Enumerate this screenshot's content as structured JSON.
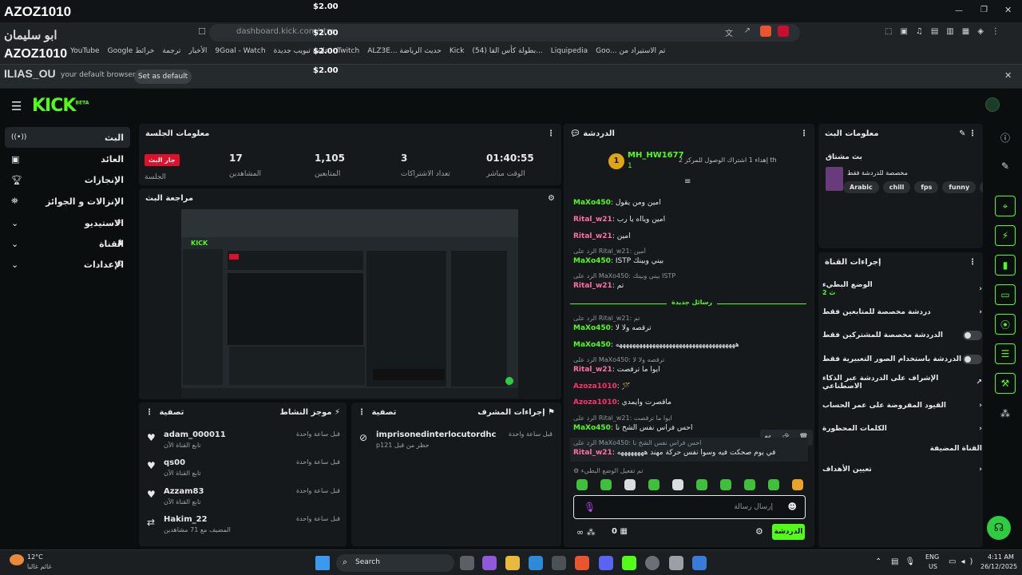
{
  "overlay": {
    "line1": "AZOZ1010",
    "line2": "ابو سليمان",
    "line3": "AZOZ1010",
    "line4": "ILIAS_OU",
    "donations": [
      "$2.00",
      "$2.00",
      "$2.00",
      "$2.00"
    ]
  },
  "browser": {
    "url": "dashboard.kick.com/stre",
    "default_prompt": "your default browser",
    "set_default": "Set as default",
    "bookmarks": [
      "YouTube",
      "Google خرائط",
      "ترجمة",
      "الأخبار",
      "9Goal - Watch",
      "علامة تبويب جديدة",
      "Twitch",
      "ALZ3E... حديث الرياضة",
      "Kick",
      "(54) بطولة كأس القا...",
      "Liquipedia",
      "Goo... تم الاستيراد من"
    ]
  },
  "sidebar": {
    "items": [
      {
        "label": "البث",
        "icon": "broadcast-icon"
      },
      {
        "label": "العائد",
        "icon": "dollar-icon"
      },
      {
        "label": "الإنجازات",
        "icon": "trophy-icon"
      },
      {
        "label": "الإنزالات و الجوائز",
        "icon": "gift-icon"
      },
      {
        "label": "الاستيديو",
        "icon": "studio-icon"
      },
      {
        "label": "القناة",
        "icon": "channel-icon"
      },
      {
        "label": "الإعدادات",
        "icon": "gear-icon"
      }
    ]
  },
  "session": {
    "title": "معلومات الجلسة",
    "live": "جار البث",
    "session_label": "الجلسة",
    "stats": [
      {
        "value": "17",
        "label": "المشاهدين"
      },
      {
        "value": "1,105",
        "label": "المتابعين"
      },
      {
        "value": "3",
        "label": "تعداد الاشتراكات"
      },
      {
        "value": "01:40:55",
        "label": "الوقت مباشر"
      }
    ]
  },
  "review": {
    "title": "مراجعة البث"
  },
  "activity": {
    "title": "موجز النشاط",
    "filter": "تصفية",
    "items": [
      {
        "name": "adam_000011",
        "sub": "تابع القناة الآن",
        "time": "قبل ساعة واحدة",
        "icon": "heart-icon"
      },
      {
        "name": "qs00",
        "sub": "تابع القناة الآن",
        "time": "قبل ساعة واحدة",
        "icon": "heart-icon"
      },
      {
        "name": "Azzam83",
        "sub": "تابع القناة الآن",
        "time": "قبل ساعة واحدة",
        "icon": "heart-icon"
      },
      {
        "name": "Hakim_22",
        "sub": "المضيف مع 71 مشاهدين",
        "time": "قبل ساعة واحدة",
        "icon": "host-icon"
      }
    ]
  },
  "modactions": {
    "title": "إجراءات المشرف",
    "filter": "تصفية",
    "items": [
      {
        "name": "imprisonedinterlocutordhc",
        "sub": "p121 حظر من قبل",
        "time": "قبل ساعة واحدة"
      }
    ]
  },
  "chat": {
    "title": "الدردشة",
    "pinned_user": "MH_HW1677",
    "pinned_text": "إهداء 1 اشتراك الوصول للمركز 2 th",
    "pinned_count": "1",
    "new_messages": "رسائل جديدة",
    "emote_only": "تم تفعيل الوضع البطيء",
    "input_placeholder": "إرسال رسالة",
    "send": "الدردشة",
    "count": "0",
    "messages": [
      {
        "user": "MaXo450",
        "color": "green",
        "text": "امين ومن يقول"
      },
      {
        "user": "Rital_w21",
        "color": "pink",
        "text": "أمين ويااه يا رب"
      },
      {
        "user": "Rital_w21",
        "color": "pink",
        "text": "أمين",
        "reply": ""
      },
      {
        "user": "MaXo450",
        "color": "green",
        "text": "ISTP بيني وبينك",
        "reply": "الرد على Rital_w21: أمين"
      },
      {
        "user": "Rital_w21",
        "color": "pink",
        "text": "تم",
        "reply": "الرد على MaXo450: بيني وبينك ISTP"
      },
      {
        "user": "MaXo450",
        "color": "green",
        "text": "ترقصه ولا لا",
        "reply": "الرد على Rital_w21: تم"
      },
      {
        "user": "MaXo450",
        "color": "green",
        "text": "ههههههههههههههههههههههههههههههههههههه"
      },
      {
        "user": "Rital_w21",
        "color": "pink",
        "text": "ايوا ما ترقصت",
        "reply": "الرد على MaXo450: ترقصه ولا لا"
      },
      {
        "user": "Azoza1010",
        "color": "mag",
        "text": "🪄"
      },
      {
        "user": "Azoza1010",
        "color": "mag",
        "text": "ماقصرت وايمدي"
      },
      {
        "user": "MaXo450",
        "color": "green",
        "text": "احس فراس نفس الشخ نا",
        "reply": "الرد على Rital_w21: ايوا ما ترقصت"
      },
      {
        "user": "Rital_w21",
        "color": "pink",
        "text": "في يوم صحكت فيه وسوا نفس حركة مهند ههههههههه",
        "reply": "الرد على MaXo450: احس فراس نفس الشخ نا"
      }
    ]
  },
  "streaminfo": {
    "title": "معلومات البث",
    "stream_name": "بث مشتاق",
    "category": "مخصصة للدردشة فقط",
    "tags": [
      "Arabic",
      "chill",
      "fps",
      "funny",
      "gam"
    ]
  },
  "channelactions": {
    "title": "إجراءات القناة",
    "items": [
      {
        "label": "الوضع البطيء",
        "sub": "2 ث",
        "type": "arrow"
      },
      {
        "label": "دردشة مخصصة للمتابعين فقط",
        "type": "arrow"
      },
      {
        "label": "الدردشة مخصصة للمشتركين فقط",
        "type": "toggle"
      },
      {
        "label": "الدردشة باستخدام الصور التعبيرية فقط",
        "type": "toggle"
      },
      {
        "label": "الإشراف على الدردشة عبر الذكاء الاصطناعي",
        "type": "link"
      },
      {
        "label": "القيود المفروضة على عمر الحساب",
        "type": "arrow"
      },
      {
        "label": "الكلمات المحظورة",
        "type": "arrow"
      },
      {
        "label": "القناة المضيفة",
        "type": "none"
      },
      {
        "label": "تعيين الأهداف",
        "type": "arrow"
      }
    ]
  },
  "taskbar": {
    "weather_temp": "12°C",
    "weather_text": "غائم غالبا",
    "search": "Search",
    "lang": "ENG",
    "region": "US",
    "time": "4:11 AM",
    "date": "26/12/2025"
  },
  "colors": {
    "kick_green": "#53fc18",
    "live_red": "#e0102a",
    "panel": "#15191b"
  }
}
